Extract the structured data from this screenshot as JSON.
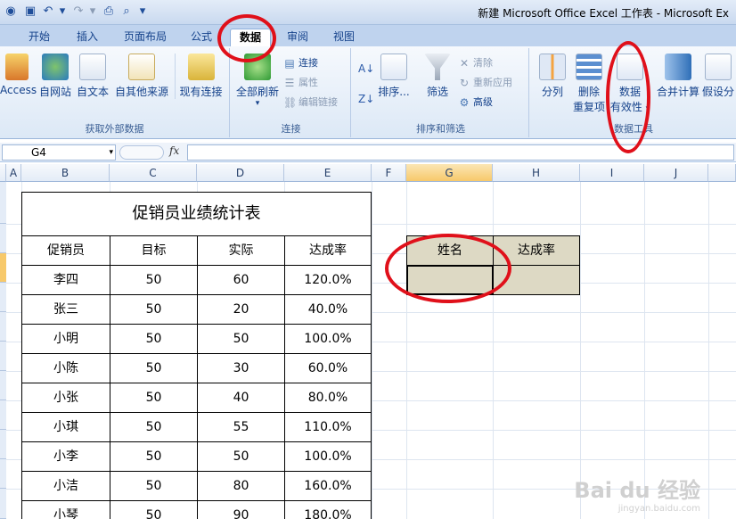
{
  "window": {
    "title": "新建 Microsoft Office Excel 工作表 - Microsoft Ex"
  },
  "ribbon_tabs": [
    {
      "label": "开始"
    },
    {
      "label": "插入"
    },
    {
      "label": "页面布局"
    },
    {
      "label": "公式"
    },
    {
      "label": "数据",
      "active": true
    },
    {
      "label": "审阅"
    },
    {
      "label": "视图"
    }
  ],
  "groups": {
    "external": {
      "label": "获取外部数据",
      "buttons": [
        "Access",
        "自网站",
        "自文本",
        "自其他来源",
        "现有连接"
      ]
    },
    "connections": {
      "label": "连接",
      "refresh_label": "全部刷新",
      "small": [
        "连接",
        "属性",
        "编辑链接"
      ]
    },
    "sort_filter": {
      "label": "排序和筛选",
      "sort_label": "排序...",
      "filter_label": "筛选",
      "small": [
        "清除",
        "重新应用",
        "高级"
      ]
    },
    "data_tools": {
      "label": "数据工具",
      "split_label": "分列",
      "remove_dup_line1": "删除",
      "remove_dup_line2": "重复项",
      "validation_line1": "数据",
      "validation_line2": "有效性",
      "consolidate_label": "合并计算",
      "whatif_label": "假设分"
    }
  },
  "formula_bar": {
    "name_box": "G4",
    "fx": "fx",
    "formula": ""
  },
  "columns": [
    "A",
    "B",
    "C",
    "D",
    "E",
    "F",
    "G",
    "H",
    "I",
    "J"
  ],
  "table": {
    "title": "促销员业绩统计表",
    "headers": [
      "促销员",
      "目标",
      "实际",
      "达成率"
    ],
    "rows": [
      [
        "李四",
        "50",
        "60",
        "120.0%"
      ],
      [
        "张三",
        "50",
        "20",
        "40.0%"
      ],
      [
        "小明",
        "50",
        "50",
        "100.0%"
      ],
      [
        "小陈",
        "50",
        "30",
        "60.0%"
      ],
      [
        "小张",
        "50",
        "40",
        "80.0%"
      ],
      [
        "小琪",
        "50",
        "55",
        "110.0%"
      ],
      [
        "小李",
        "50",
        "50",
        "100.0%"
      ],
      [
        "小洁",
        "50",
        "80",
        "160.0%"
      ],
      [
        "小琴",
        "50",
        "90",
        "180.0%"
      ]
    ]
  },
  "lookup": {
    "name_header": "姓名",
    "rate_header": "达成率",
    "name_value": "",
    "rate_value": ""
  },
  "watermark": {
    "brand": "Bai du 经验",
    "url": "jingyan.baidu.com"
  },
  "colors": {
    "annotation": "#e0101a",
    "header_fill": "#ddd9c4"
  }
}
